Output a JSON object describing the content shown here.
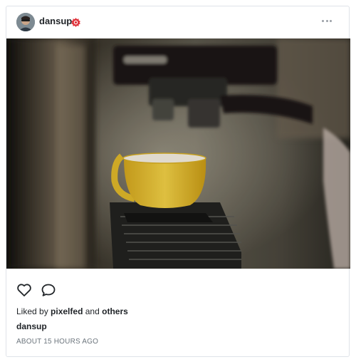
{
  "post": {
    "username": "dansup",
    "verified_icon": "verified-badge-icon",
    "menu_icon": "more-horizontal-icon",
    "image_icon": "photo-espresso-cup",
    "actions": {
      "like_icon": "heart-icon",
      "comment_icon": "comment-bubble-icon"
    },
    "likes": {
      "prefix": "Liked by",
      "user": "pixelfed",
      "conjunction": "and",
      "others": "others"
    },
    "caption_username": "dansup",
    "timestamp": "ABOUT 15 HOURS AGO"
  },
  "colors": {
    "border": "#dfe3e8",
    "verified": "#e0323a",
    "timestamp": "#6c757d",
    "cup": "#e8c431"
  }
}
